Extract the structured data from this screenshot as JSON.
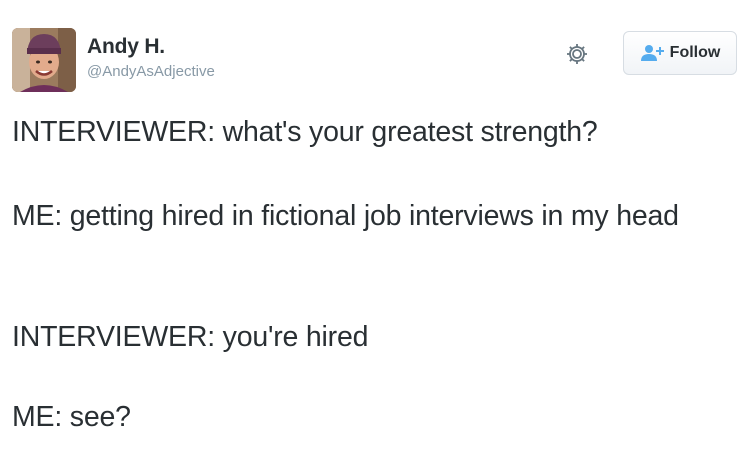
{
  "author": {
    "display_name": "Andy H.",
    "handle": "@AndyAsAdjective",
    "avatar_icon": "profile-photo"
  },
  "actions": {
    "settings_icon": "gear-icon",
    "follow_label": "Follow",
    "follow_icon": "add-person-icon"
  },
  "tweet": {
    "paragraphs": [
      "INTERVIEWER: what's your greatest strength?",
      "ME: getting hired in fictional job interviews in my head",
      "INTERVIEWER: you're hired",
      "ME: see?"
    ]
  },
  "colors": {
    "text": "#292f33",
    "handle": "#8899a6",
    "follow_icon": "#55acee"
  }
}
